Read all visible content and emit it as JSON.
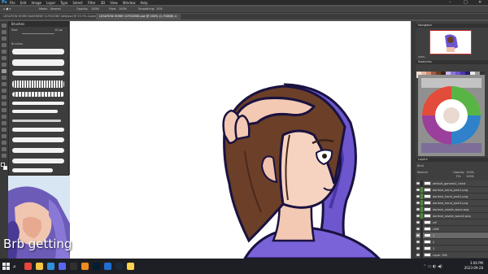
{
  "app": {
    "name": "Ps",
    "window_controls": [
      "–",
      "□",
      "✕"
    ]
  },
  "menu": [
    "File",
    "Edit",
    "Image",
    "Layer",
    "Type",
    "Select",
    "Filter",
    "3D",
    "View",
    "Window",
    "Help"
  ],
  "options_bar": {
    "mode_label": "Mode:",
    "mode_value": "Normal",
    "opacity_label": "Opacity:",
    "opacity_value": "100%",
    "flow_label": "Flow:",
    "flow_value": "100%",
    "smoothing_label": "Smoothing:",
    "smoothing_value": "10%"
  },
  "document_tabs": [
    {
      "label": "LEGATION HOME BASEMENT CUTSCENE 2bW.psd @ 33.3% (Layer 8, RGB/8) ×",
      "active": false
    },
    {
      "label": "LEGATION HOME CUTSCENE.psd @ 200% (1, RGB/8) ×",
      "active": true
    }
  ],
  "brushes_panel": {
    "title": "Brushes",
    "size_label": "Size:",
    "size_value": "10 px",
    "group": "Brushes"
  },
  "overlay_text": "Brb getting",
  "navigator": {
    "title": "Navigator",
    "zoom": "200%"
  },
  "swatches": {
    "title": "Swatches"
  },
  "layers_panel": {
    "title": "Layers",
    "kind_label": "Kind",
    "blend_mode": "Normal",
    "opacity_label": "Opacity:",
    "opacity_value": "100%",
    "fill_label": "Fill:",
    "fill_value": "100%",
    "layers": [
      {
        "name": "default_gamma1_hand",
        "color": "#2b2b2b",
        "selected": false
      },
      {
        "name": "darlene_hand_pink1.png",
        "color": "#4c8a3a",
        "selected": false
      },
      {
        "name": "darlene_hand_pink2.png",
        "color": "#4c8a3a",
        "selected": false
      },
      {
        "name": "darlene_hand_pink3.png",
        "color": "#4c8a3a",
        "selected": false
      },
      {
        "name": "darlene_shade_wave.png",
        "color": "#4c8a3a",
        "selected": false
      },
      {
        "name": "darlene_shade_wave2.png",
        "color": "#4c8a3a",
        "selected": false
      },
      {
        "name": "ref",
        "color": "#2b2b2b",
        "selected": false
      },
      {
        "name": "LINE",
        "color": "#2b2b2b",
        "selected": false
      },
      {
        "name": "1",
        "color": "#2b2b2b",
        "selected": true
      },
      {
        "name": "2",
        "color": "#2b2b2b",
        "selected": false
      },
      {
        "name": "3",
        "color": "#2b2b2b",
        "selected": false
      },
      {
        "name": "Layer 106",
        "color": "#2b2b2b",
        "selected": false
      }
    ]
  },
  "taskbar": {
    "search_icon": "search-icon",
    "time": "3:06 PM",
    "date": "2023-09-28",
    "apps": [
      {
        "name": "chrome",
        "color": "#e8453c"
      },
      {
        "name": "explorer",
        "color": "#f4c542"
      },
      {
        "name": "edge",
        "color": "#2f8fd8"
      },
      {
        "name": "discord",
        "color": "#5865f2"
      },
      {
        "name": "obs",
        "color": "#303030"
      },
      {
        "name": "vlc",
        "color": "#f08a1e"
      },
      {
        "name": "photoshop",
        "color": "#001e36"
      },
      {
        "name": "mail",
        "color": "#1f6fd1"
      },
      {
        "name": "steam",
        "color": "#1b2838"
      },
      {
        "name": "notes",
        "color": "#ffd34e"
      }
    ]
  }
}
